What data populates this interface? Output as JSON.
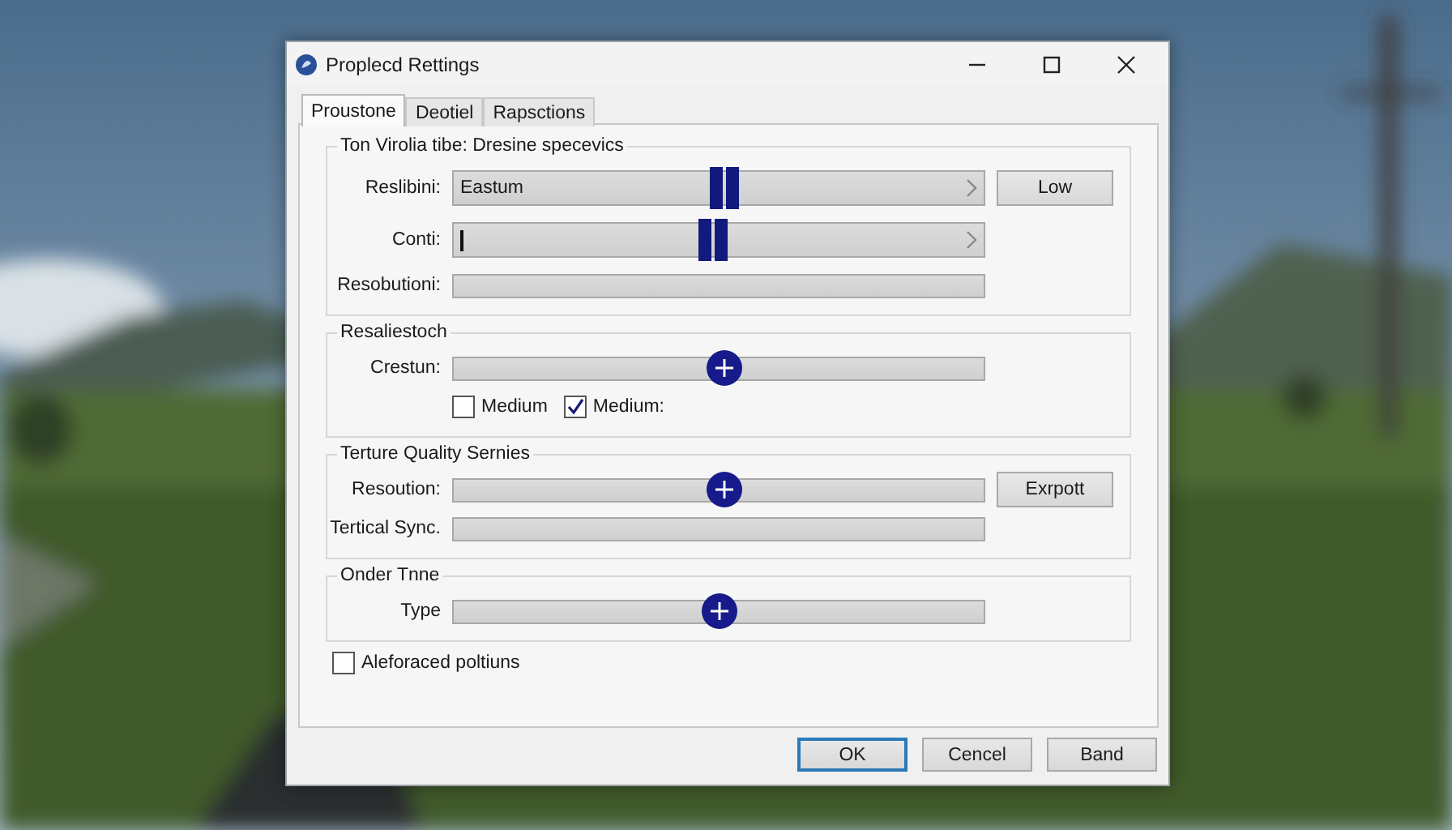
{
  "window": {
    "title": "Proplecd Rettings"
  },
  "tabs": [
    {
      "label": "Proustone",
      "selected": true
    },
    {
      "label": "Deotiel",
      "selected": false
    },
    {
      "label": "Rapsctions",
      "selected": false
    }
  ],
  "sections": [
    {
      "legend": "Ton Virolia tibe: Dresine specevics",
      "rows": [
        {
          "kind": "combo",
          "label": "Reslibini:",
          "value": "Eastum",
          "level": 0.51,
          "button": "Low"
        },
        {
          "kind": "combo",
          "label": "Conti:",
          "level": 0.49
        },
        {
          "kind": "track",
          "label": "Resobutioni:"
        }
      ]
    },
    {
      "legend": "Resaliestoch",
      "rows": [
        {
          "kind": "slider",
          "label": "Crestun:",
          "level": 0.51
        },
        {
          "kind": "checks",
          "checks": [
            {
              "label": "Medium",
              "checked": false
            },
            {
              "label": "Medium:",
              "checked": true
            }
          ]
        }
      ]
    },
    {
      "legend": "Terture Quality Sernies",
      "rows": [
        {
          "kind": "slider",
          "label": "Resoution:",
          "level": 0.51,
          "button": "Exrpott"
        },
        {
          "kind": "track",
          "label": "Tertical Sync."
        }
      ]
    },
    {
      "legend": "Onder Tnne",
      "rows": [
        {
          "kind": "slider",
          "label": "Type",
          "level": 0.5
        }
      ]
    }
  ],
  "option": {
    "label": "Aleforaced poltiuns",
    "checked": false
  },
  "buttons": [
    {
      "label": "OK",
      "selected": true
    },
    {
      "label": "Cencel",
      "selected": false
    },
    {
      "label": "Band",
      "selected": false
    }
  ]
}
